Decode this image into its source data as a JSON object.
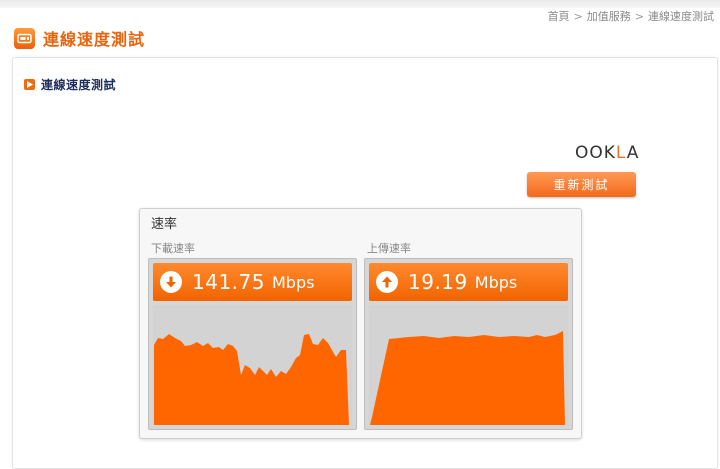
{
  "breadcrumb": [
    "首頁",
    "加值服務",
    "連線速度測試"
  ],
  "breadcrumb_sep": ">",
  "page_title": "連線速度測試",
  "section_heading": "連線速度測試",
  "logo": {
    "prefix": "OOK",
    "accent": "L",
    "suffix": "A"
  },
  "retest_button": "重新測試",
  "speed_panel": {
    "title": "速率",
    "download": {
      "label": "下載速率",
      "value": "141.75",
      "unit": "Mbps",
      "icon": "arrow-down-icon"
    },
    "upload": {
      "label": "上傳速率",
      "value": "19.19",
      "unit": "Mbps",
      "icon": "arrow-up-icon"
    }
  },
  "colors": {
    "accent": "#f26300",
    "title_orange": "#e86510",
    "heading_navy": "#1e2f5e",
    "graph_fill": "#ff6600"
  }
}
